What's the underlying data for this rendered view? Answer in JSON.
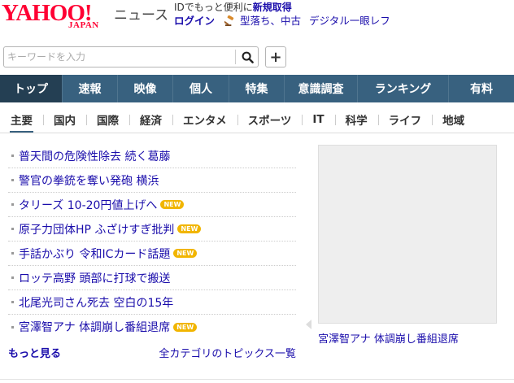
{
  "header": {
    "logo_text": "YAHOO!",
    "logo_sub": "JAPAN",
    "service_name": "ニュース",
    "promo_text": "IDでもっと便利に",
    "promo_link": "新規取得",
    "login_label": "ログイン",
    "links": [
      "型落ち、中古",
      "デジタル一眼レフ"
    ]
  },
  "search": {
    "placeholder": "キーワードを入力",
    "button_icon": "search-icon",
    "add_label": "+"
  },
  "nav": {
    "items": [
      "トップ",
      "速報",
      "映像",
      "個人",
      "特集",
      "意識調査",
      "ランキング",
      "有料"
    ],
    "active": "トップ"
  },
  "subnav": {
    "items": [
      "主要",
      "国内",
      "国際",
      "経済",
      "エンタメ",
      "スポーツ",
      "IT",
      "科学",
      "ライフ",
      "地域"
    ],
    "active": "主要"
  },
  "topics": {
    "items": [
      {
        "title": "普天間の危険性除去 続く葛藤",
        "badge": ""
      },
      {
        "title": "警官の拳銃を奪い発砲 横浜",
        "badge": ""
      },
      {
        "title": "タリーズ 10-20円値上げへ",
        "badge": "NEW"
      },
      {
        "title": "原子力団体HP ふざけすぎ批判",
        "badge": "NEW"
      },
      {
        "title": "手話かぶり 令和ICカード話題",
        "badge": "NEW"
      },
      {
        "title": "ロッテ高野 頭部に打球で搬送",
        "badge": ""
      },
      {
        "title": "北尾光司さん死去 空白の15年",
        "badge": ""
      },
      {
        "title": "宮澤智アナ 体調崩し番組退席",
        "badge": "NEW"
      }
    ],
    "more_label": "もっと見る",
    "all_label": "全カテゴリのトピックス一覧"
  },
  "photo": {
    "caption": "宮澤智アナ 体調崩し番組退席"
  },
  "colors": {
    "brand_red": "#ff0033",
    "nav_bg": "#38617f",
    "nav_active": "#243f53",
    "link": "#1a0dab",
    "new_badge": "#f1b500"
  }
}
